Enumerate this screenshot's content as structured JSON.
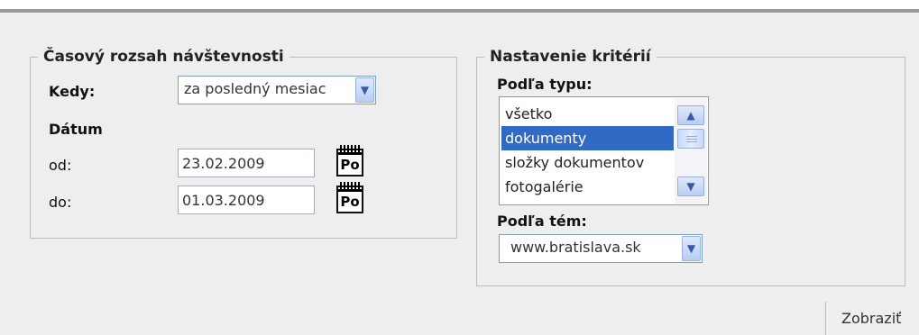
{
  "time_range": {
    "legend": "Časový rozsah návštevnosti",
    "when_label": "Kedy:",
    "when_value": "za posledný mesiac",
    "date_label": "Dátum",
    "from_label": "od:",
    "from_value": "23.02.2009",
    "to_label": "do:",
    "to_value": "01.03.2009",
    "calendar_icon_text": "Po"
  },
  "criteria": {
    "legend": "Nastavenie kritérií",
    "by_type_label": "Podľa typu:",
    "type_options": [
      "všetko",
      "dokumenty",
      "složky dokumentov",
      "fotogalérie"
    ],
    "selected_type": "dokumenty",
    "by_topic_label": "Podľa tém:",
    "topic_value": "www.bratislava.sk"
  },
  "actions": {
    "show_label": "Zobraziť"
  },
  "colors": {
    "background": "#eeeeee",
    "selection": "#316ac5",
    "border": "#bdbdbd"
  }
}
